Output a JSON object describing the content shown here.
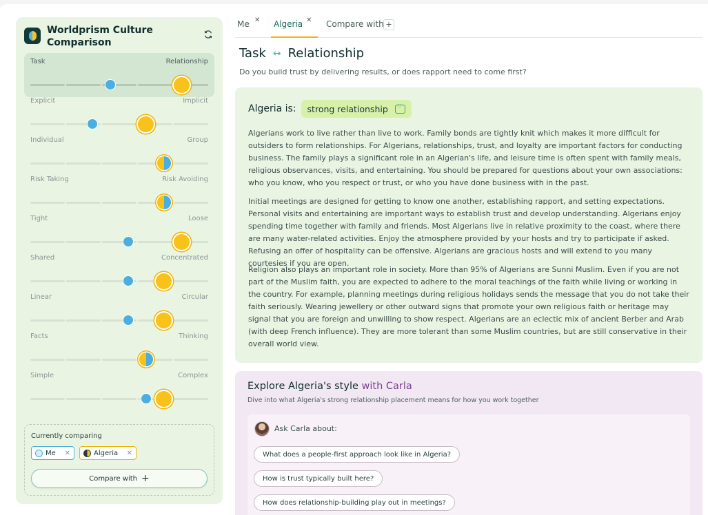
{
  "app": {
    "title": "Worldprism Culture Comparison"
  },
  "dimensions": [
    {
      "left": "Task",
      "right": "Relationship",
      "me": 0.45,
      "algeria": 0.85,
      "active": true
    },
    {
      "left": "Explicit",
      "right": "Implicit",
      "me": 0.35,
      "algeria": 0.65
    },
    {
      "left": "Individual",
      "right": "Group",
      "algeria": 0.75,
      "overlap": true
    },
    {
      "left": "Risk Taking",
      "right": "Risk Avoiding",
      "algeria": 0.75,
      "overlap": true
    },
    {
      "left": "Tight",
      "right": "Loose",
      "me": 0.55,
      "algeria": 0.85
    },
    {
      "left": "Shared",
      "right": "Concentrated",
      "me": 0.55,
      "algeria": 0.75
    },
    {
      "left": "Linear",
      "right": "Circular",
      "me": 0.55,
      "algeria": 0.75
    },
    {
      "left": "Facts",
      "right": "Thinking",
      "algeria": 0.65,
      "overlap": true
    },
    {
      "left": "Simple",
      "right": "Complex",
      "me": 0.65,
      "algeria": 0.75
    }
  ],
  "comparing": {
    "title": "Currently comparing",
    "chips": [
      "Me",
      "Algeria"
    ],
    "compare_button": "Compare with"
  },
  "tabs": [
    {
      "label": "Me",
      "closable": true
    },
    {
      "label": "Algeria",
      "closable": true,
      "active": true
    },
    {
      "label": "Compare with",
      "add": "+"
    }
  ],
  "main": {
    "heading_left": "Task",
    "heading_right": "Relationship",
    "question": "Do you build trust by delivering results, or does rapport need to come first?",
    "panel_title": "Algeria is:",
    "badge": "strong relationship",
    "paragraphs": [
      "Algerians work to live rather than live to work. Family bonds are tightly knit which makes it more difficult for outsiders to form relationships. For Algerians, relationships, trust, and loyalty are important factors for conducting business. The family plays a significant role in an Algerian's life, and leisure time is often spent with family meals, religious observances, visits, and entertaining. You should be prepared for questions about your own associations: who you know, who you respect or trust, or who you have done business with in the past.",
      "Initial meetings are designed for getting to know one another, establishing rapport, and setting expectations. Personal visits and entertaining are important ways to establish trust and develop understanding. Algerians enjoy spending time together with family and friends. Most Algerians live in relative proximity to the coast, where there are many water-related activities. Enjoy the atmosphere provided by your hosts and try to participate if asked. Refusing an offer of hospitality can be offensive. Algerians are gracious hosts and will extend to you many courtesies if you are open.",
      "Religion also plays an important role in society. More than 95% of Algerians are Sunni Muslim. Even if you are not part of the Muslim faith, you are expected to adhere to the moral teachings of the faith while living or working in the country. For example, planning meetings during religious holidays sends the message that you do not take their faith seriously. Wearing jewellery or other outward signs that promote your own religious faith or heritage may signal that you are foreign and unwilling to show respect. Algerians are an eclectic mix of ancient Berber and Arab (with deep French influence). They are more tolerant than some Muslim countries, but are still conservative in their overall world view."
    ]
  },
  "explore": {
    "title_prefix": "Explore Algeria's style",
    "title_suffix": "with Carla",
    "subtitle": "Dive into what Algeria's strong relationship placement means for how you work together",
    "ask_label": "Ask Carla about:",
    "questions": [
      "What does a people-first approach look like in Algeria?",
      "How is trust typically built here?",
      "How does relationship-building play out in meetings?"
    ]
  }
}
